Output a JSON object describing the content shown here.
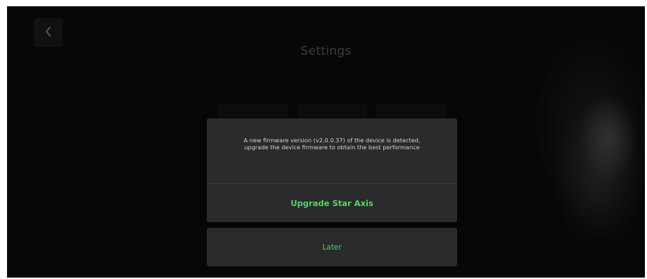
{
  "header": {
    "title": "Settings",
    "back_icon": "chevron-left-icon"
  },
  "dialog": {
    "message": "A new firmware version (v2.0.0.37) of the device is detected, upgrade the device firmware to obtain the best performance",
    "primary_action": "Upgrade Star Axis",
    "secondary_action": "Later"
  },
  "colors": {
    "background": "#0b0b0c",
    "dialog_bg": "#2a2b2d",
    "accent_green": "#57d169",
    "title_gray": "#5d5d60"
  }
}
